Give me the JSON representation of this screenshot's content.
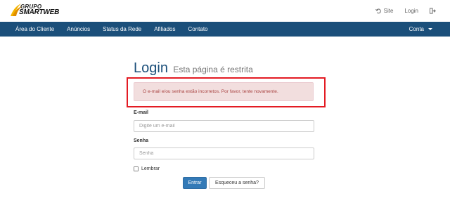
{
  "header": {
    "logo_line1": "GRUPO",
    "logo_line2": "SMARTWEB",
    "links": {
      "site": "Site",
      "login": "Login"
    }
  },
  "nav": {
    "items": [
      "Área do Cliente",
      "Anúncios",
      "Status da Rede",
      "Afiliados",
      "Contato"
    ],
    "account": "Conta"
  },
  "login": {
    "title": "Login",
    "subtitle": "Esta página é restrita",
    "error": "O e-mail e/ou senha estão incorretos. Por favor, tente novamente.",
    "email_label": "E-mail",
    "email_placeholder": "Digite um e-mail",
    "password_label": "Senha",
    "password_placeholder": "Senha",
    "remember": "Lembrar",
    "submit": "Entrar",
    "forgot": "Esqueceu a senha?"
  },
  "colors": {
    "nav_bg": "#1b4f7a",
    "title": "#1b4f7a",
    "alert_bg": "#f2dede",
    "alert_text": "#a94442",
    "highlight_border": "#e31b23",
    "primary_button": "#337ab7",
    "logo_accent": "#f4b400"
  }
}
